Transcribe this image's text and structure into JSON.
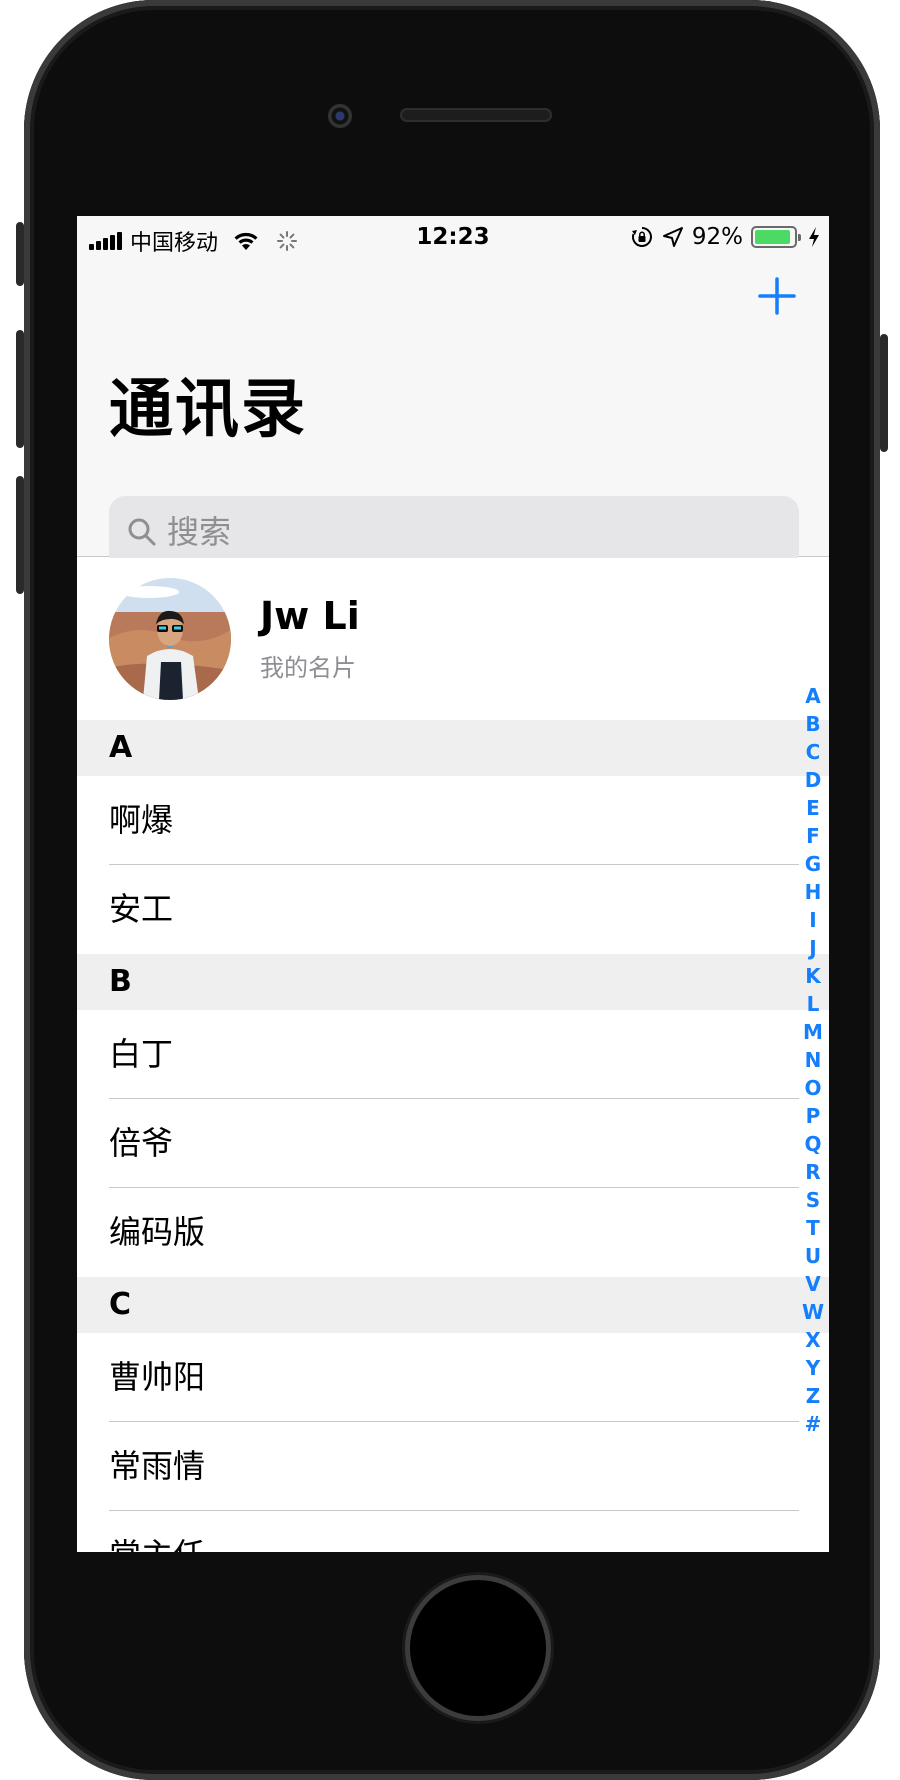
{
  "status_bar": {
    "carrier": "中国移动",
    "time": "12:23",
    "battery_percent_text": "92%",
    "battery_level": 0.92
  },
  "header": {
    "title": "通讯录",
    "add_icon": "plus-icon"
  },
  "search": {
    "placeholder": "搜索",
    "icon": "search-icon"
  },
  "my_card": {
    "name": "Jw Li",
    "subtitle": "我的名片"
  },
  "sections": [
    {
      "letter": "A",
      "contacts": [
        "啊爆",
        "安工"
      ]
    },
    {
      "letter": "B",
      "contacts": [
        "白丁",
        "倍爷",
        "编码版"
      ]
    },
    {
      "letter": "C",
      "contacts": [
        "曹帅阳",
        "常雨情",
        "常主任"
      ]
    }
  ],
  "index": [
    "A",
    "B",
    "C",
    "D",
    "E",
    "F",
    "G",
    "H",
    "I",
    "J",
    "K",
    "L",
    "M",
    "N",
    "O",
    "P",
    "Q",
    "R",
    "S",
    "T",
    "U",
    "V",
    "W",
    "X",
    "Y",
    "Z",
    "#"
  ],
  "colors": {
    "accent": "#147efb",
    "battery": "#4cd964"
  }
}
